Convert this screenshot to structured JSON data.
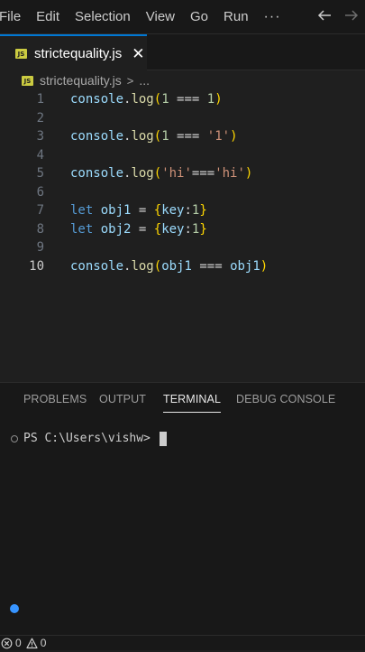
{
  "menu": {
    "items": [
      "File",
      "Edit",
      "Selection",
      "View",
      "Go",
      "Run"
    ],
    "more": "···"
  },
  "tab": {
    "label": "strictequality.js",
    "close": "✕",
    "icon": "js-file-icon",
    "badge": "JS"
  },
  "breadcrumb": {
    "file": "strictequality.js",
    "separator": ">",
    "more": "..."
  },
  "editor": {
    "active_line": 10,
    "lines": [
      {
        "num": "1",
        "tokens": [
          {
            "t": "console",
            "c": "c-fn"
          },
          {
            "t": ".",
            "c": "c-op"
          },
          {
            "t": "log",
            "c": "c-meth"
          },
          {
            "t": "(",
            "c": "c-p1"
          },
          {
            "t": "1",
            "c": "c-num"
          },
          {
            "t": " === ",
            "c": "c-op"
          },
          {
            "t": "1",
            "c": "c-num"
          },
          {
            "t": ")",
            "c": "c-p1"
          }
        ]
      },
      {
        "num": "2",
        "tokens": []
      },
      {
        "num": "3",
        "tokens": [
          {
            "t": "console",
            "c": "c-fn"
          },
          {
            "t": ".",
            "c": "c-op"
          },
          {
            "t": "log",
            "c": "c-meth"
          },
          {
            "t": "(",
            "c": "c-p1"
          },
          {
            "t": "1",
            "c": "c-num"
          },
          {
            "t": " === ",
            "c": "c-op"
          },
          {
            "t": "'1'",
            "c": "c-str"
          },
          {
            "t": ")",
            "c": "c-p1"
          }
        ]
      },
      {
        "num": "4",
        "tokens": []
      },
      {
        "num": "5",
        "tokens": [
          {
            "t": "console",
            "c": "c-fn"
          },
          {
            "t": ".",
            "c": "c-op"
          },
          {
            "t": "log",
            "c": "c-meth"
          },
          {
            "t": "(",
            "c": "c-p1"
          },
          {
            "t": "'hi'",
            "c": "c-str"
          },
          {
            "t": "===",
            "c": "c-op"
          },
          {
            "t": "'hi'",
            "c": "c-str"
          },
          {
            "t": ")",
            "c": "c-p1"
          }
        ]
      },
      {
        "num": "6",
        "tokens": []
      },
      {
        "num": "7",
        "tokens": [
          {
            "t": "let",
            "c": "c-kw"
          },
          {
            "t": " ",
            "c": "c-op"
          },
          {
            "t": "obj1",
            "c": "c-var"
          },
          {
            "t": " = ",
            "c": "c-op"
          },
          {
            "t": "{",
            "c": "c-p1"
          },
          {
            "t": "key",
            "c": "c-var"
          },
          {
            "t": ":",
            "c": "c-op"
          },
          {
            "t": "1",
            "c": "c-num"
          },
          {
            "t": "}",
            "c": "c-p1"
          }
        ]
      },
      {
        "num": "8",
        "tokens": [
          {
            "t": "let",
            "c": "c-kw"
          },
          {
            "t": " ",
            "c": "c-op"
          },
          {
            "t": "obj2",
            "c": "c-var"
          },
          {
            "t": " = ",
            "c": "c-op"
          },
          {
            "t": "{",
            "c": "c-p1"
          },
          {
            "t": "key",
            "c": "c-var"
          },
          {
            "t": ":",
            "c": "c-op"
          },
          {
            "t": "1",
            "c": "c-num"
          },
          {
            "t": "}",
            "c": "c-p1"
          }
        ]
      },
      {
        "num": "9",
        "tokens": []
      },
      {
        "num": "10",
        "tokens": [
          {
            "t": "console",
            "c": "c-fn"
          },
          {
            "t": ".",
            "c": "c-op"
          },
          {
            "t": "log",
            "c": "c-meth"
          },
          {
            "t": "(",
            "c": "c-p1"
          },
          {
            "t": "obj1",
            "c": "c-var"
          },
          {
            "t": " === ",
            "c": "c-op"
          },
          {
            "t": "obj1",
            "c": "c-var"
          },
          {
            "t": ")",
            "c": "c-p1"
          }
        ]
      }
    ]
  },
  "panel": {
    "tabs": [
      {
        "label": "PROBLEMS",
        "active": false
      },
      {
        "label": "OUTPUT",
        "active": false
      },
      {
        "label": "TERMINAL",
        "active": true
      },
      {
        "label": "DEBUG CONSOLE",
        "active": false
      }
    ],
    "terminal_prompt": "PS C:\\Users\\vishw>"
  },
  "status": {
    "errors": "0",
    "warnings": "0"
  },
  "colors": {
    "accent": "#0078d4",
    "background": "#1f1f1f",
    "js_badge": "#cbcb41",
    "terminal_dot": "#3794ff"
  }
}
